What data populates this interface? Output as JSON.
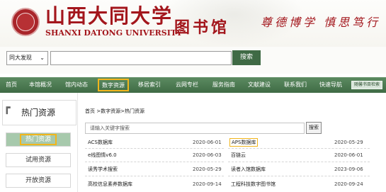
{
  "header": {
    "university_cn": "山西大同大学",
    "university_en": "SHANXI DATONG UNIVERSITY",
    "library_cn": "图书馆",
    "motto": "尊德博学 慎思笃行"
  },
  "search": {
    "scope_value": "同大发现",
    "scope_options": [
      "同大发现"
    ],
    "query_value": "",
    "button_label": "搜索"
  },
  "nav": {
    "items": [
      {
        "label": "首页"
      },
      {
        "label": "本馆概况"
      },
      {
        "label": "馆内动态"
      },
      {
        "label": "数字资源"
      },
      {
        "label": "移居索引"
      },
      {
        "label": "云网专栏"
      },
      {
        "label": "服务指南"
      },
      {
        "label": "文献建设"
      },
      {
        "label": "联系我们"
      },
      {
        "label": "快速导航"
      }
    ],
    "active_index": 3,
    "special_label": "随馨书目检索"
  },
  "sidebar": {
    "title": "热门资源",
    "items": [
      {
        "label": "热门资源",
        "active": true
      },
      {
        "label": "试用资源",
        "active": false
      },
      {
        "label": "开放资源",
        "active": false
      }
    ]
  },
  "main": {
    "breadcrumb": "首页 >数字资源>热门资源",
    "keyword_placeholder": "请输入关键字搜索",
    "keyword_button": "搜索",
    "databases": [
      {
        "name": "ACS数据库",
        "date": "2020-06-01"
      },
      {
        "name": "APS数据库",
        "date": "2020-05-29"
      },
      {
        "name": "e线图情v6.0",
        "date": "2020-06-03"
      },
      {
        "name": "百链云",
        "date": "2020-06-01"
      },
      {
        "name": "读秀学术搜索",
        "date": "2020-05-29"
      },
      {
        "name": "读者入馆数据库",
        "date": "2023-09-06"
      },
      {
        "name": "高校信息素养数据库",
        "date": "2020-09-14"
      },
      {
        "name": "工程科技数字图书馆",
        "date": "2020-09-24"
      }
    ]
  },
  "colors": {
    "brand_red": "#a3161c",
    "nav_green": "#4a7650",
    "highlight_orange": "#f1b51c",
    "active_side_green": "#a7c9ac"
  }
}
